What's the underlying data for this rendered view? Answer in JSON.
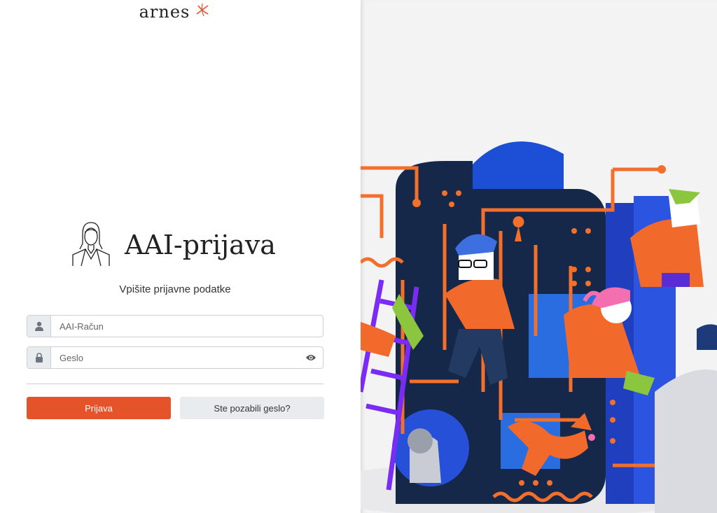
{
  "brand": {
    "name": "arnes"
  },
  "login": {
    "title": "AAI-prijava",
    "subtitle": "Vpišite prijavne podatke",
    "username_placeholder": "AAI-Račun",
    "password_placeholder": "Geslo",
    "submit_label": "Prijava",
    "forgot_label": "Ste pozabili geslo?"
  },
  "colors": {
    "accent": "#e5532b",
    "secondary_button": "#e9ecef"
  },
  "icons": [
    "arnes-logo-icon",
    "user-avatar-icon",
    "user-icon",
    "lock-icon",
    "eye-icon"
  ]
}
